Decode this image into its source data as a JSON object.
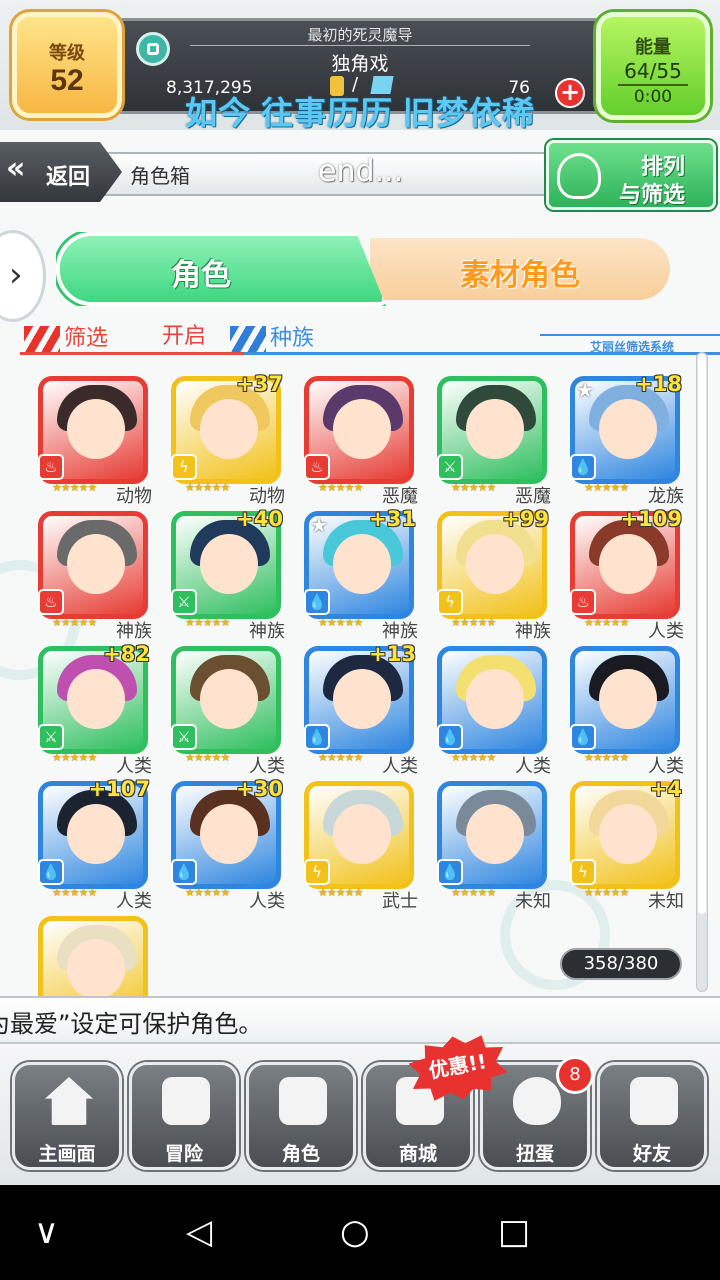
{
  "header": {
    "level_label": "等级",
    "level_value": "52",
    "subtitle": "最初的死灵魔导",
    "nickname": "独角戏",
    "gold": "8,317,295",
    "gems": "76",
    "plus": "+",
    "energy_label": "能量",
    "energy_value": "64/55",
    "energy_timer": "0:00",
    "lyric": "如今 往事历历 旧梦依稀"
  },
  "nav": {
    "back_label": "返回",
    "title": "角色箱",
    "overlay_text": "end...",
    "sort_line1": "排列",
    "sort_line2": "与筛选"
  },
  "tabs": {
    "characters": "角色",
    "materials": "素材角色"
  },
  "filter": {
    "label": "筛选",
    "value": "开启",
    "race": "种族",
    "system_name": "艾丽丝筛选系统"
  },
  "cards": [
    {
      "race": "动物",
      "plus": "",
      "element": "fire",
      "fav": false
    },
    {
      "race": "动物",
      "plus": "+37",
      "element": "thunder",
      "fav": false
    },
    {
      "race": "恶魔",
      "plus": "",
      "element": "fire",
      "fav": false
    },
    {
      "race": "恶魔",
      "plus": "",
      "element": "wind",
      "fav": false
    },
    {
      "race": "龙族",
      "plus": "+18",
      "element": "water",
      "fav": true
    },
    {
      "race": "神族",
      "plus": "",
      "element": "fire",
      "fav": false
    },
    {
      "race": "神族",
      "plus": "+40",
      "element": "wind",
      "fav": false
    },
    {
      "race": "神族",
      "plus": "+31",
      "element": "water",
      "fav": true
    },
    {
      "race": "神族",
      "plus": "+99",
      "element": "thunder",
      "fav": false
    },
    {
      "race": "人类",
      "plus": "+109",
      "element": "fire",
      "fav": false
    },
    {
      "race": "人类",
      "plus": "+82",
      "element": "wind",
      "fav": false
    },
    {
      "race": "人类",
      "plus": "",
      "element": "wind",
      "fav": false
    },
    {
      "race": "人类",
      "plus": "+13",
      "element": "water",
      "fav": false
    },
    {
      "race": "人类",
      "plus": "",
      "element": "water",
      "fav": false
    },
    {
      "race": "人类",
      "plus": "",
      "element": "water",
      "fav": false
    },
    {
      "race": "人类",
      "plus": "+107",
      "element": "water",
      "fav": false
    },
    {
      "race": "人类",
      "plus": "+30",
      "element": "water",
      "fav": false
    },
    {
      "race": "武士",
      "plus": "",
      "element": "thunder",
      "fav": false
    },
    {
      "race": "未知",
      "plus": "",
      "element": "water",
      "fav": false
    },
    {
      "race": "未知",
      "plus": "+4",
      "element": "thunder",
      "fav": false
    },
    {
      "race": "",
      "plus": "",
      "element": "thunder",
      "fav": false
    }
  ],
  "stars": "★★★★★",
  "element_colors": {
    "fire": "#e63c33",
    "thunder": "#f2c21b",
    "wind": "#2fbf5e",
    "water": "#2f86e0"
  },
  "element_icons": {
    "fire": "♨",
    "thunder": "ϟ",
    "wind": "⚔",
    "water": "💧"
  },
  "box_count": "358/380",
  "ticker": "为最爱”设定可保护角色。",
  "menu": [
    {
      "label": "主画面",
      "icon": "home-icon"
    },
    {
      "label": "冒险",
      "icon": "handshake-icon"
    },
    {
      "label": "角色",
      "icon": "rabbit-icon"
    },
    {
      "label": "商城",
      "icon": "cart-icon"
    },
    {
      "label": "扭蛋",
      "icon": "egg-icon"
    },
    {
      "label": "好友",
      "icon": "friends-icon"
    }
  ],
  "promo_label": "优惠!!",
  "gacha_badge": "8",
  "system_nav": {
    "down": "∨",
    "back": "◁",
    "home": "○",
    "recent": "□"
  }
}
